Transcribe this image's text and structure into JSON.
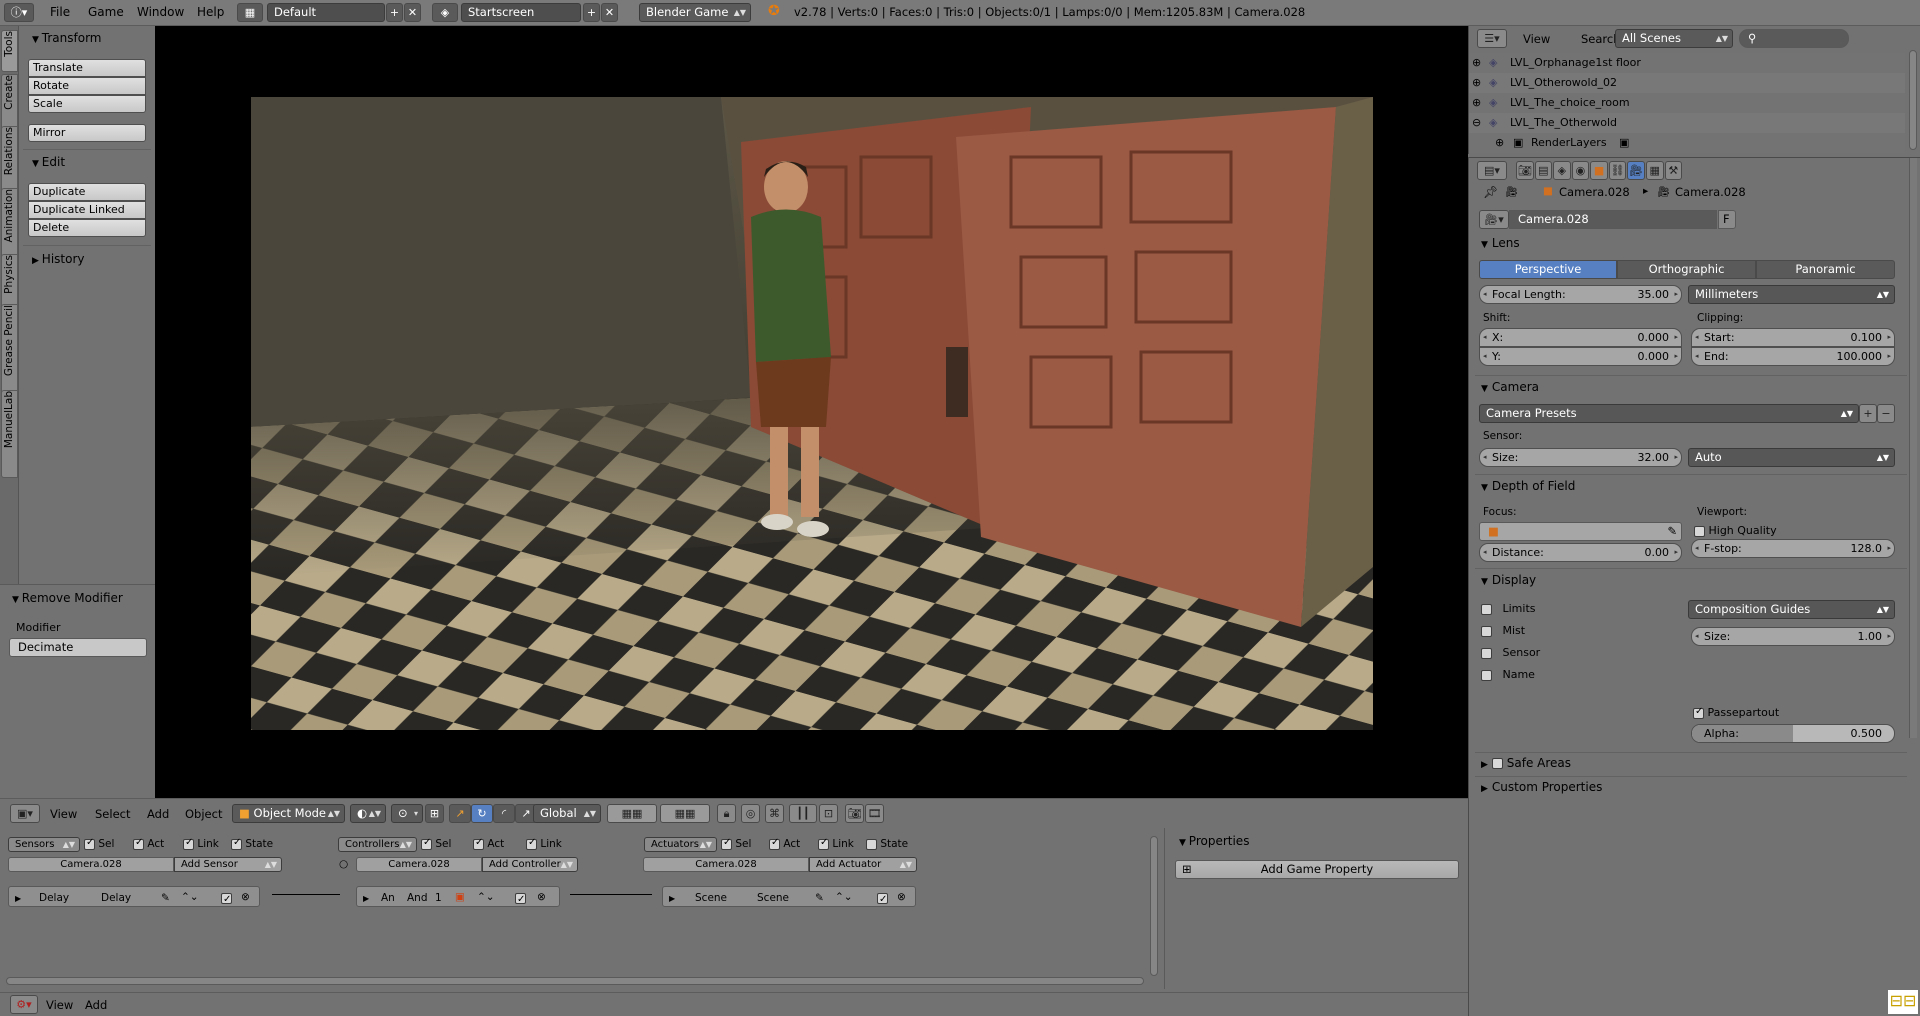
{
  "topbar": {
    "menus": [
      "File",
      "Game",
      "Window",
      "Help"
    ],
    "layout": "Default",
    "scene": "Startscreen",
    "engine": "Blender Game",
    "stats": "v2.78 | Verts:0 | Faces:0 | Tris:0 | Objects:0/1 | Lamps:0/0 | Mem:1205.83M | Camera.028"
  },
  "tool_tabs": [
    "Tools",
    "Create",
    "Relations",
    "Animation",
    "Physics",
    "Grease Pencil",
    "ManuelLab"
  ],
  "tools": {
    "transform_title": "Transform",
    "transform": [
      "Translate",
      "Rotate",
      "Scale"
    ],
    "mirror": "Mirror",
    "edit_title": "Edit",
    "edit": [
      "Duplicate",
      "Duplicate Linked",
      "Delete"
    ],
    "history_title": "History"
  },
  "operator": {
    "title": "Remove Modifier",
    "label": "Modifier",
    "value": "Decimate"
  },
  "viewport_header": {
    "menus": [
      "View",
      "Select",
      "Add",
      "Object"
    ],
    "mode": "Object Mode",
    "orientation": "Global"
  },
  "logic": {
    "sensors": {
      "dropdown": "Sensors",
      "checks": [
        "Sel",
        "Act",
        "Link",
        "State"
      ],
      "object": "Camera.028",
      "add": "Add Sensor",
      "brick_type": "Delay",
      "brick_name": "Delay"
    },
    "controllers": {
      "dropdown": "Controllers",
      "checks": [
        "Sel",
        "Act",
        "Link"
      ],
      "object": "Camera.028",
      "add": "Add Controller",
      "brick_type": "An",
      "brick_name": "And",
      "brick_num": "1"
    },
    "actuators": {
      "dropdown": "Actuators",
      "checks": [
        "Sel",
        "Act",
        "Link",
        "State"
      ],
      "object": "Camera.028",
      "add": "Add Actuator",
      "brick_type": "Scene",
      "brick_name": "Scene"
    },
    "properties_title": "Properties",
    "add_property": "Add Game Property"
  },
  "bottombar": {
    "menus": [
      "View",
      "Add"
    ]
  },
  "outliner": {
    "menus": [
      "View",
      "Search"
    ],
    "filter": "All Scenes",
    "rows": [
      "LVL_Orphanage1st floor",
      "LVL_Otherowold_02",
      "LVL_The_choice_room",
      "LVL_The_Otherwold",
      "RenderLayers"
    ]
  },
  "properties": {
    "breadcrumb": [
      "Camera.028",
      "Camera.028"
    ],
    "datablock": "Camera.028",
    "datablock_flag": "F",
    "lens": {
      "title": "Lens",
      "types": [
        "Perspective",
        "Orthographic",
        "Panoramic"
      ],
      "focal_length_label": "Focal Length:",
      "focal_length": "35.00",
      "lens_unit": "Millimeters",
      "shift_label": "Shift:",
      "shift_x_label": "X:",
      "shift_x": "0.000",
      "shift_y_label": "Y:",
      "shift_y": "0.000",
      "clipping_label": "Clipping:",
      "start_label": "Start:",
      "start": "0.100",
      "end_label": "End:",
      "end": "100.000"
    },
    "camera": {
      "title": "Camera",
      "presets": "Camera Presets",
      "sensor_label": "Sensor:",
      "size_label": "Size:",
      "size": "32.00",
      "fit": "Auto"
    },
    "dof": {
      "title": "Depth of Field",
      "focus_label": "Focus:",
      "distance_label": "Distance:",
      "distance": "0.00",
      "viewport_label": "Viewport:",
      "high_quality": "High Quality",
      "fstop_label": "F-stop:",
      "fstop": "128.0"
    },
    "display": {
      "title": "Display",
      "checks": [
        "Limits",
        "Mist",
        "Sensor",
        "Name"
      ],
      "guides": "Composition Guides",
      "size_label": "Size:",
      "size": "1.00",
      "passepartout": "Passepartout",
      "alpha_label": "Alpha:",
      "alpha": "0.500",
      "alpha_fraction": 0.5
    },
    "safe_areas": "Safe Areas",
    "custom_props": "Custom Properties"
  }
}
